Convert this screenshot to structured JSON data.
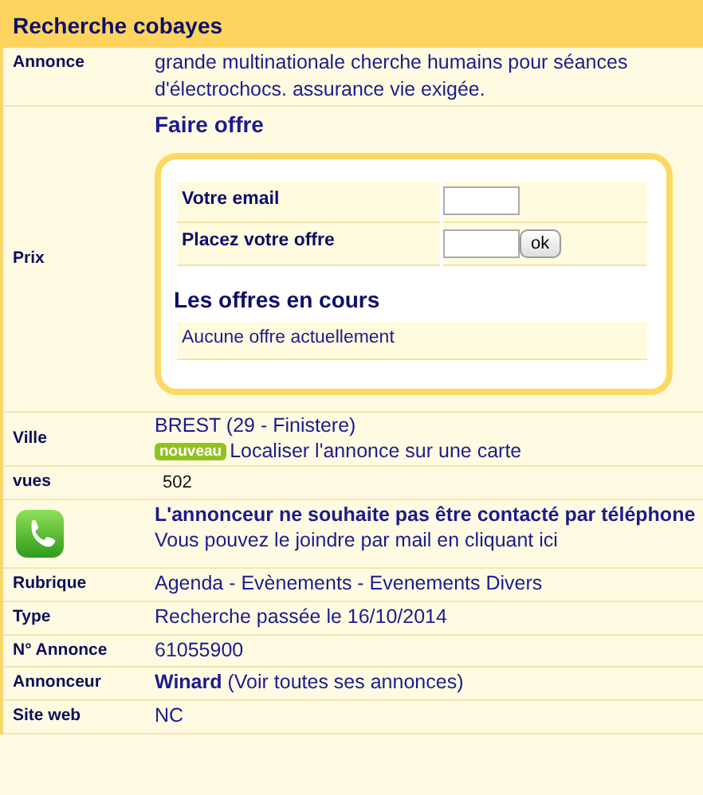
{
  "title": "Recherche cobayes",
  "rows": [
    {
      "kind": "text",
      "label": "Annonce",
      "value": "grande multinationale cherche humains pour séances d'électrochocs. assurance vie exigée."
    },
    {
      "kind": "offer",
      "label": "Prix",
      "offer_title": "Faire offre",
      "fields": [
        {
          "label": "Votre email"
        },
        {
          "label": "Placez votre offre",
          "button": "ok"
        }
      ],
      "bids_title": "Les offres en cours",
      "bids_note": "Aucune offre actuellement"
    },
    {
      "kind": "location",
      "label": "Ville",
      "value": "BREST (29 - Finistere)",
      "badge": "nouveau",
      "link": "Localiser l'annonce sur une carte"
    },
    {
      "kind": "counter",
      "label": "vues",
      "value": "502"
    },
    {
      "kind": "phone",
      "notice": "**L'annonceur ne souhaite pas être contacté par téléphone** Vous pouvez le joindre par mail en cliquant ici"
    },
    {
      "kind": "text",
      "label": "Rubrique",
      "value": "Agenda - Evènements - Evenements Divers"
    },
    {
      "kind": "text",
      "label": "Type",
      "value": "Recherche passée le 16/10/2014"
    },
    {
      "kind": "text",
      "label": "N° Annonce",
      "value": "61055900"
    },
    {
      "kind": "author",
      "label": "Annonceur",
      "name": "Winard",
      "link": "(Voir toutes ses annonces)"
    },
    {
      "kind": "text",
      "label": "Site web",
      "value": "NC"
    }
  ]
}
